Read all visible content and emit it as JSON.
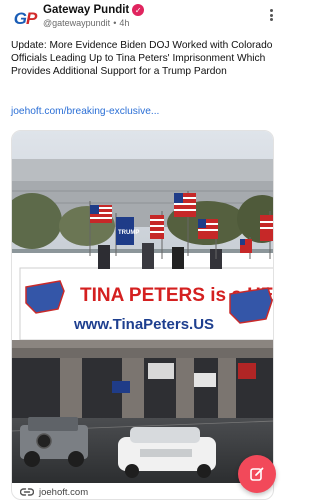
{
  "post": {
    "author": {
      "name": "Gateway Pundit",
      "handle": "@gatewaypundit",
      "time": "4h",
      "avatar_text_g": "G",
      "avatar_text_p": "P"
    },
    "text": "Update: More Evidence Biden DOJ Worked with Colorado Officials Leading Up to Tina Peters' Imprisonment Which Provides Additional Support for a Trump Pardon",
    "link": "joehoft.com/breaking-exclusive...",
    "card": {
      "domain": "joehoft.com",
      "banner_line1": "TINA PETERS is a HERO!!",
      "banner_line2": "www.TinaPeters.US",
      "flag_text": "TRUMP"
    }
  },
  "icons": {
    "verified": "verified-badge-icon",
    "more": "more-options-icon",
    "link": "link-icon",
    "compose": "compose-icon"
  },
  "colors": {
    "accent": "#f2495a",
    "link": "#2b6fd6",
    "verified": "#e0245e"
  }
}
